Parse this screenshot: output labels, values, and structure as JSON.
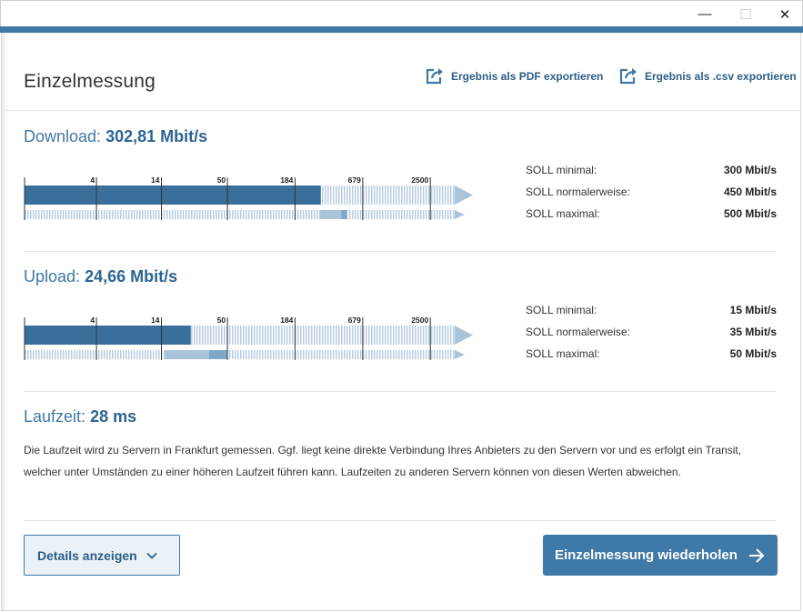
{
  "window": {
    "minimize": "—",
    "maximize": "☐",
    "close": "✕"
  },
  "header": {
    "title": "Einzelmessung",
    "export_pdf": "Ergebnis als PDF exportieren",
    "export_csv": "Ergebnis als .csv exportieren"
  },
  "gauge_scale": [
    "4",
    "14",
    "50",
    "184",
    "679",
    "2500"
  ],
  "download": {
    "label": "Download:",
    "value": "302,81 Mbit/s",
    "measured_mbits": 302.81,
    "soll_min_mbits": 300,
    "soll_normal_mbits": 450,
    "soll_max_mbits": 500,
    "soll": [
      {
        "label": "SOLL minimal:",
        "value": "300 Mbit/s"
      },
      {
        "label": "SOLL normalerweise:",
        "value": "450 Mbit/s"
      },
      {
        "label": "SOLL maximal:",
        "value": "500 Mbit/s"
      }
    ]
  },
  "upload": {
    "label": "Upload:",
    "value": "24,66 Mbit/s",
    "measured_mbits": 24.66,
    "soll_min_mbits": 15,
    "soll_normal_mbits": 35,
    "soll_max_mbits": 50,
    "soll": [
      {
        "label": "SOLL minimal:",
        "value": "15 Mbit/s"
      },
      {
        "label": "SOLL normalerweise:",
        "value": "35 Mbit/s"
      },
      {
        "label": "SOLL maximal:",
        "value": "50 Mbit/s"
      }
    ]
  },
  "laufzeit": {
    "label": "Laufzeit:",
    "value": "28 ms",
    "description_line1": "Die Laufzeit wird zu Servern in Frankfurt gemessen. Ggf. liegt keine direkte Verbindung Ihres Anbieters zu den Servern vor und es erfolgt ein Transit,",
    "description_line2": "welcher unter Umständen zu einer höheren Laufzeit führen kann. Laufzeiten zu anderen Servern können von diesen Werten abweichen."
  },
  "buttons": {
    "details": "Details anzeigen",
    "repeat": "Einzelmessung wiederholen"
  },
  "colors": {
    "accent": "#3f79a7",
    "bar_dark": "#3a6f9b",
    "bar_light": "#a9c3d9",
    "stripe": "#b7cde0"
  }
}
